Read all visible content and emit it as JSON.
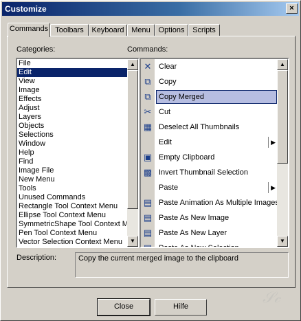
{
  "window": {
    "title": "Customize",
    "close_label": "×"
  },
  "tabs": [
    "Commands",
    "Toolbars",
    "Keyboard",
    "Menu",
    "Options",
    "Scripts"
  ],
  "labels": {
    "categories": "Categories:",
    "commands": "Commands:",
    "description": "Description:"
  },
  "categories": [
    "File",
    "Edit",
    "View",
    "Image",
    "Effects",
    "Adjust",
    "Layers",
    "Objects",
    "Selections",
    "Window",
    "Help",
    "Find",
    "Image File",
    "New Menu",
    "Tools",
    "Unused Commands",
    "Rectangle Tool Context Menu",
    "Ellipse Tool Context Menu",
    "SymmetricShape Tool Context M",
    "Pen Tool Context Menu",
    "Vector Selection Context Menu"
  ],
  "selected_category": "Edit",
  "commands": [
    {
      "label": "Clear",
      "icon": "clear-icon",
      "glyph": "✕"
    },
    {
      "label": "Copy",
      "icon": "copy-icon",
      "glyph": "⧉"
    },
    {
      "label": "Copy Merged",
      "icon": "copy-merged-icon",
      "glyph": "⧉",
      "selected": true
    },
    {
      "label": "Cut",
      "icon": "cut-icon",
      "glyph": "✂"
    },
    {
      "label": "Deselect All Thumbnails",
      "icon": "thumbnails-icon",
      "glyph": "▦"
    },
    {
      "label": "Edit",
      "icon": "",
      "glyph": "",
      "submenu": true
    },
    {
      "label": "Empty Clipboard",
      "icon": "empty-clipboard-icon",
      "glyph": "▣"
    },
    {
      "label": "Invert Thumbnail Selection",
      "icon": "invert-thumbnails-icon",
      "glyph": "▩"
    },
    {
      "label": "Paste",
      "icon": "",
      "glyph": "",
      "submenu": true
    },
    {
      "label": "Paste Animation As Multiple Images",
      "icon": "paste-animation-icon",
      "glyph": "▤"
    },
    {
      "label": "Paste As New Image",
      "icon": "paste-new-image-icon",
      "glyph": "▤"
    },
    {
      "label": "Paste As New Layer",
      "icon": "paste-new-layer-icon",
      "glyph": "▤"
    },
    {
      "label": "Paste As New Selection",
      "icon": "paste-new-selection-icon",
      "glyph": "▤"
    }
  ],
  "description": "Copy the current merged image to the clipboard",
  "buttons": {
    "close": "Close",
    "help": "Hilfe"
  },
  "colors": {
    "selection": "#0a246a",
    "command_highlight": "#b6bde1"
  }
}
